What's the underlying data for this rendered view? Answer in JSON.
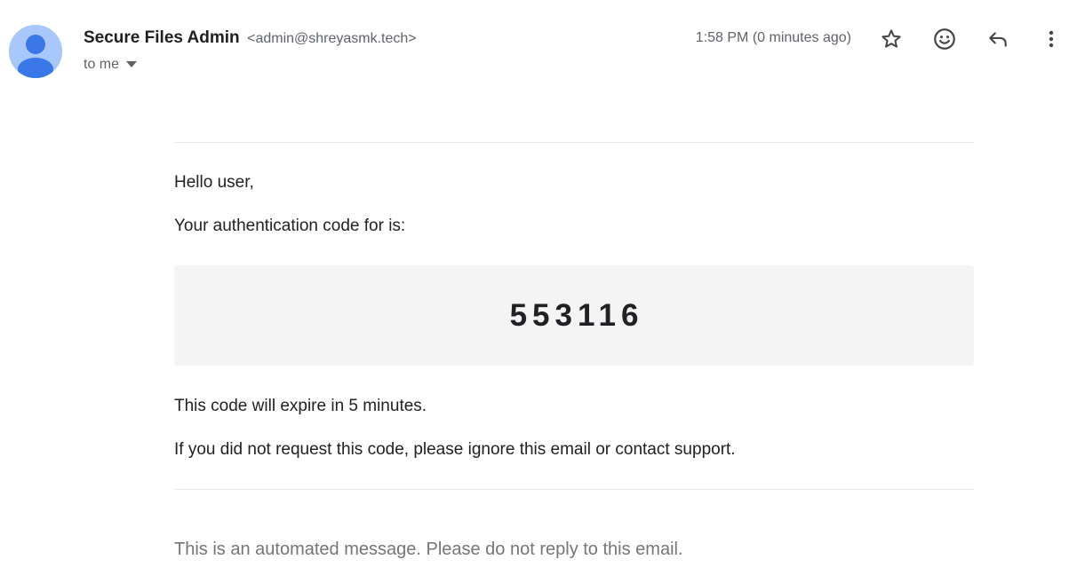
{
  "header": {
    "sender_name": "Secure Files Admin",
    "sender_email": "<admin@shreyasmk.tech>",
    "to_label": "to me",
    "timestamp": "1:58 PM (0 minutes ago)",
    "actions": [
      "star-icon",
      "emoji-icon",
      "reply-icon",
      "more-vert-icon"
    ]
  },
  "body": {
    "greeting": "Hello user,",
    "intro": "Your authentication code for is:",
    "code": "553116",
    "expiry": "This code will expire in 5 minutes.",
    "notice": "If you did not request this code, please ignore this email or contact support.",
    "footer": "This is an automated message. Please do not reply to this email."
  },
  "colors": {
    "avatar_bg": "#a8c7fa",
    "avatar_figure": "#4285f4",
    "code_box_bg": "#f4f4f4",
    "muted_text": "#5f6368"
  }
}
